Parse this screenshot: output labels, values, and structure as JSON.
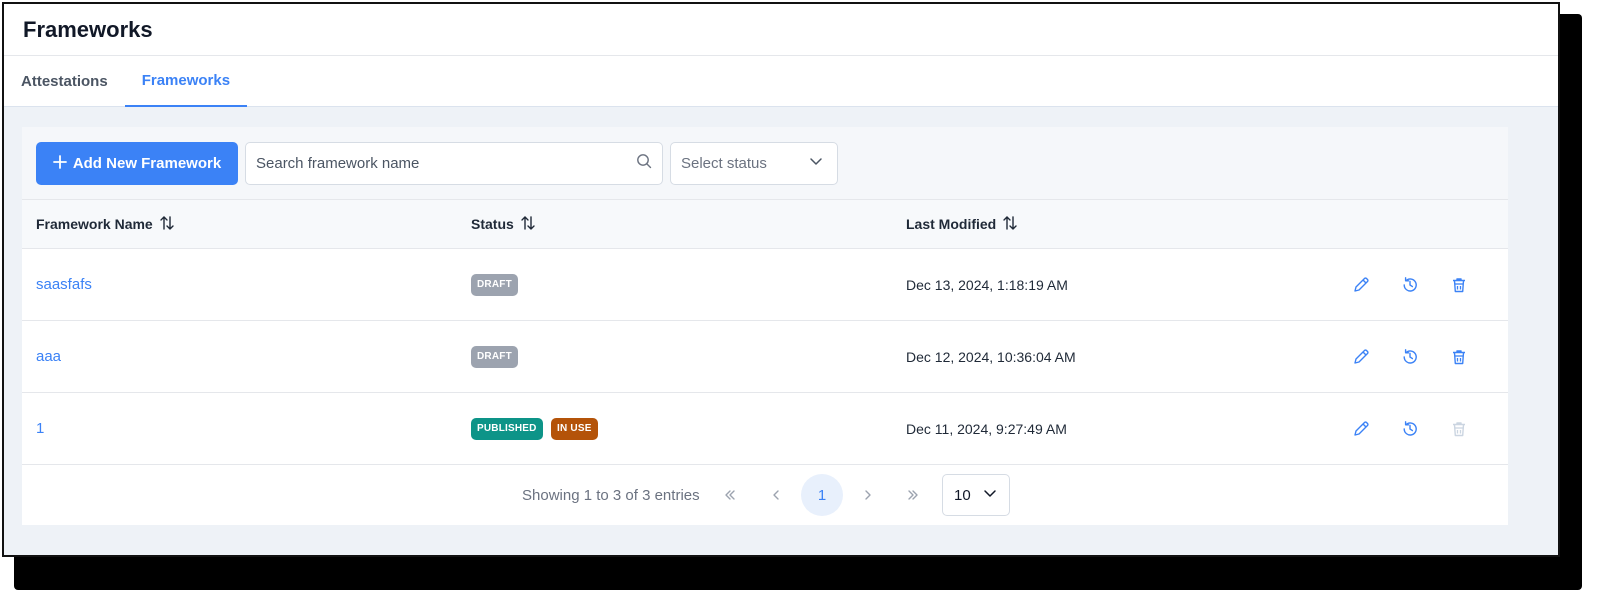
{
  "page": {
    "title": "Frameworks"
  },
  "tabs": [
    {
      "label": "Attestations",
      "active": false
    },
    {
      "label": "Frameworks",
      "active": true
    }
  ],
  "toolbar": {
    "add_button_label": "Add New Framework",
    "search_placeholder": "Search framework name",
    "status_select_placeholder": "Select status"
  },
  "table": {
    "columns": [
      "Framework Name",
      "Status",
      "Last Modified"
    ],
    "rows": [
      {
        "name": "saasfafs",
        "badges": [
          "DRAFT"
        ],
        "last_modified": "Dec 13, 2024, 1:18:19 AM",
        "delete_disabled": false
      },
      {
        "name": "aaa",
        "badges": [
          "DRAFT"
        ],
        "last_modified": "Dec 12, 2024, 10:36:04 AM",
        "delete_disabled": false
      },
      {
        "name": "1",
        "badges": [
          "PUBLISHED",
          "IN USE"
        ],
        "last_modified": "Dec 11, 2024, 9:27:49 AM",
        "delete_disabled": true
      }
    ]
  },
  "pagination": {
    "showing_text": "Showing 1 to 3 of 3 entries",
    "current_page": "1",
    "page_size": "10"
  },
  "colors": {
    "accent": "#3b82f6",
    "draft": "#9ca3af",
    "published": "#0d9488",
    "in_use": "#b45309"
  },
  "icons": [
    "plus-icon",
    "search-icon",
    "chevron-down-icon",
    "sort-icon",
    "edit-icon",
    "history-icon",
    "trash-icon",
    "double-chevron-left-icon",
    "chevron-left-icon",
    "chevron-right-icon",
    "double-chevron-right-icon"
  ]
}
